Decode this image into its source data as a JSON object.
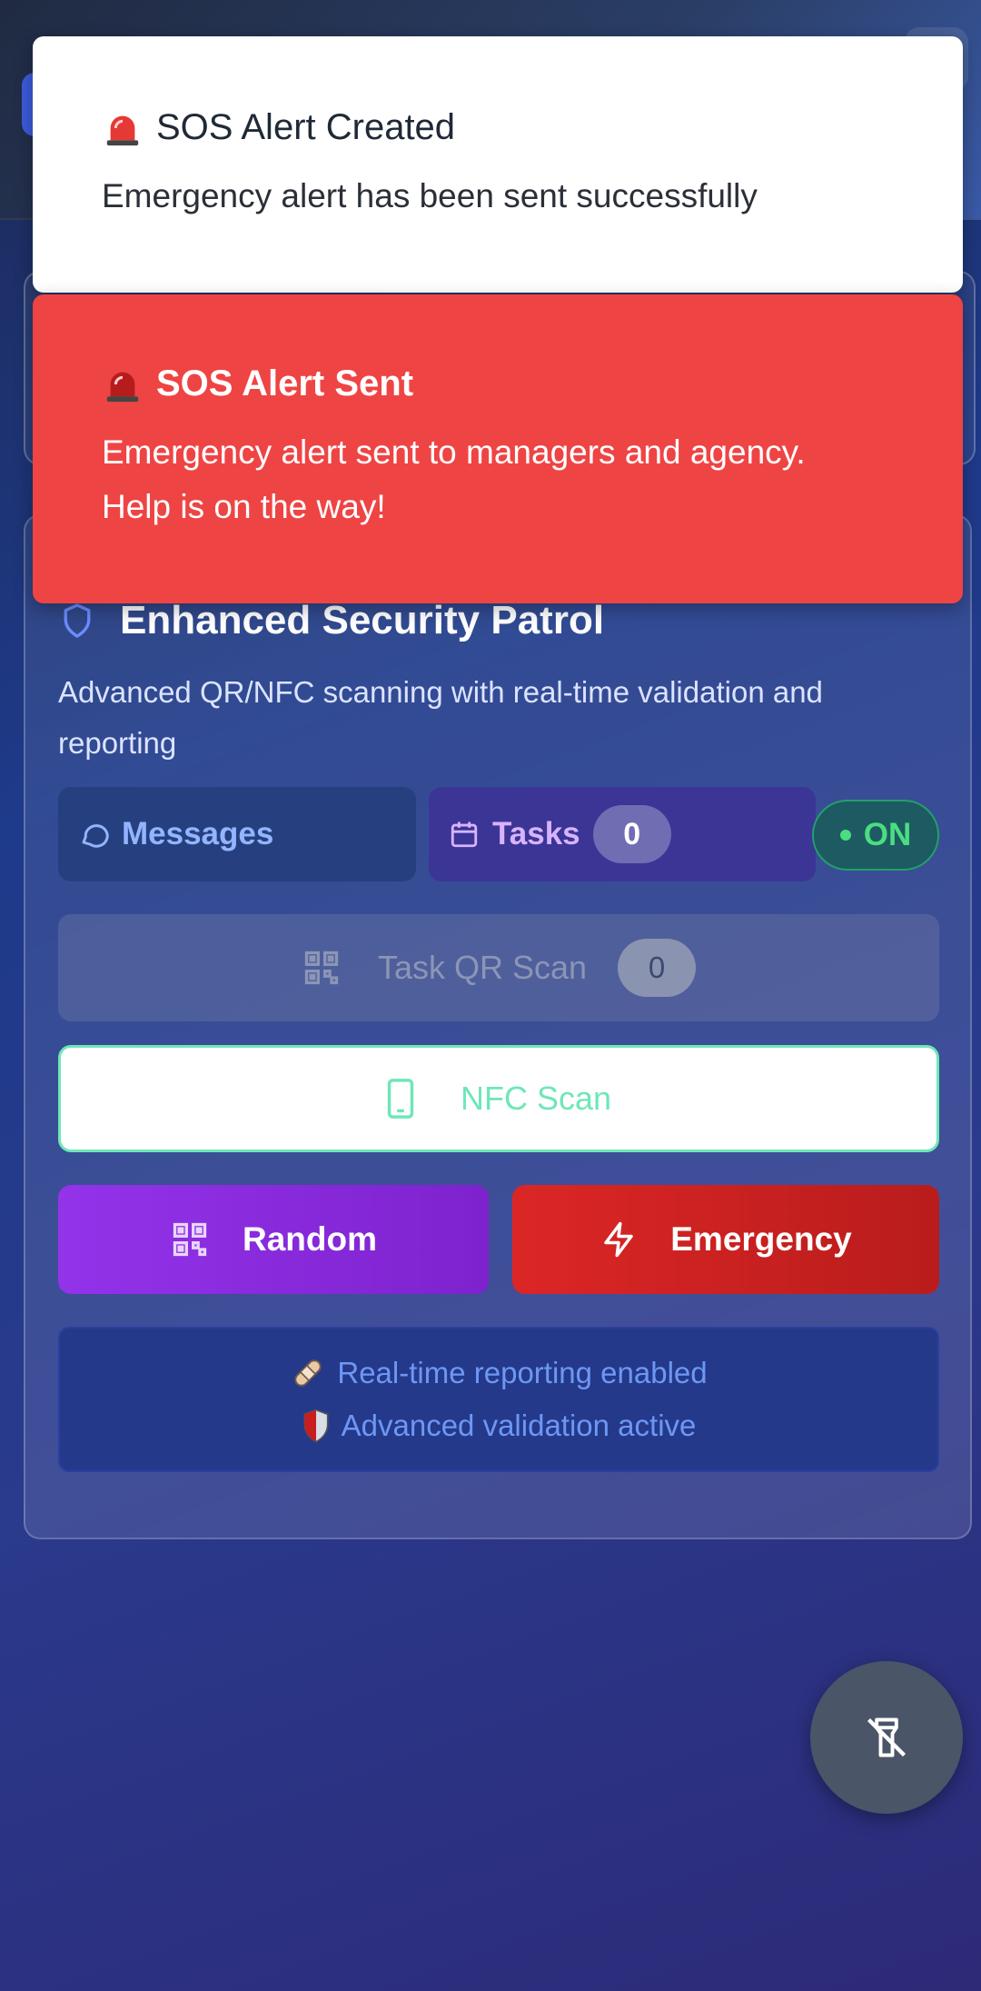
{
  "toasts": {
    "created": {
      "title": "SOS Alert Created",
      "description": "Emergency alert has been sent successfully"
    },
    "sent": {
      "title": "SOS Alert Sent",
      "description": "Emergency alert sent to managers and agency. Help is on the way!"
    }
  },
  "patrol_card": {
    "title": "Enhanced Security Patrol",
    "description": "Advanced QR/NFC scanning with real-time validation and reporting",
    "messages_label": "Messages",
    "tasks_label": "Tasks",
    "tasks_count": "0",
    "status_label": "ON",
    "task_qr_label": "Task QR Scan",
    "task_qr_count": "0",
    "nfc_label": "NFC Scan",
    "random_label": "Random",
    "emergency_label": "Emergency",
    "info_line1": "Real-time reporting enabled",
    "info_line2": "Advanced validation active"
  },
  "icons": {
    "toast": "siren-icon",
    "title": "shield-icon",
    "messages": "message-circle-icon",
    "tasks": "calendar-icon",
    "qr": "qr-code-icon",
    "nfc": "smartphone-icon",
    "emergency": "zap-icon",
    "info1": "bandage-icon",
    "info2": "shield-emoji-icon",
    "fab": "flashlight-off-icon"
  },
  "colors": {
    "toast_red": "#ef4444",
    "random": "#9333ea",
    "emergency": "#dc2626",
    "nfc_accent": "#6ee7b7",
    "status_green": "#4ade80"
  }
}
